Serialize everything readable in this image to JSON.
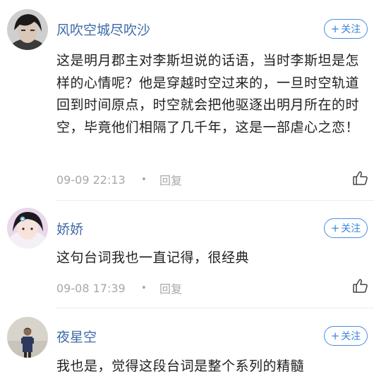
{
  "comments": [
    {
      "username": "风吹空城尽吹沙",
      "follow_label": "关注",
      "text": "这是明月郡主对李斯坦说的话语，当时李斯坦是怎样的心情呢？他是穿越时空过来的，一旦时空轨道回到时间原点，时空就会把他驱逐出明月所在的时空，毕竟他们相隔了几千年，这是一部虐心之恋！",
      "timestamp": "09-09 22:13",
      "reply_label": "回复",
      "like_icon": "thumbs-up-icon"
    },
    {
      "username": "娇娇",
      "follow_label": "关注",
      "text": "这句台词我也一直记得，很经典",
      "timestamp": "09-08 17:39",
      "reply_label": "回复",
      "like_icon": "thumbs-up-icon"
    },
    {
      "username": "夜星空",
      "follow_label": "关注",
      "text": "我也是，觉得这段台词是整个系列的精髓",
      "timestamp": "",
      "reply_label": "",
      "like_icon": "thumbs-up-icon"
    }
  ],
  "colors": {
    "username": "#3e6aa8",
    "follow_border": "#4a8de0",
    "meta": "#a8a8a8",
    "text": "#1f1f1f"
  }
}
